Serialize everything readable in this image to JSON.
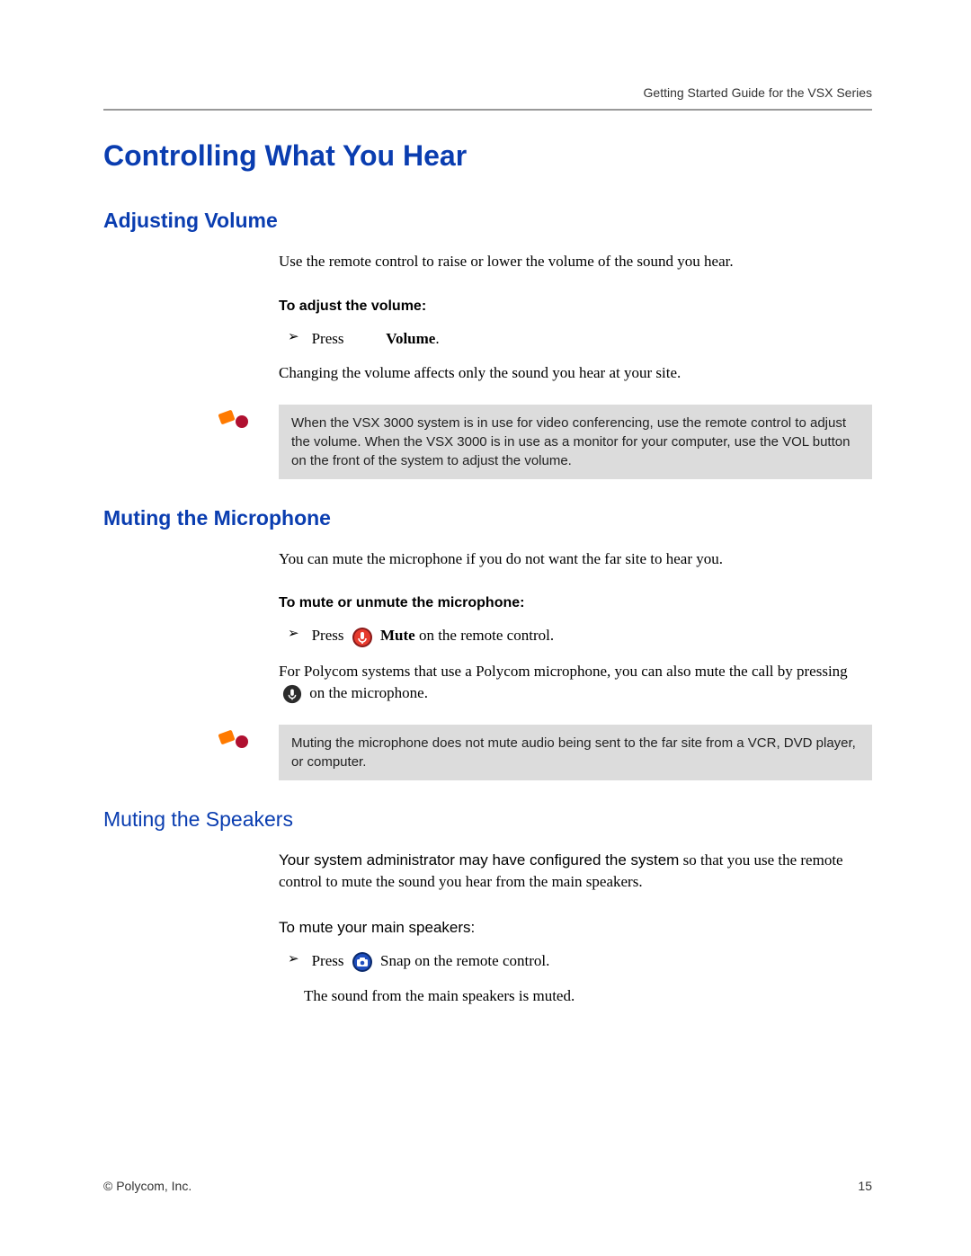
{
  "header": {
    "guide_title": "Getting Started Guide for the VSX Series"
  },
  "h1": "Controlling What You Hear",
  "sections": {
    "adjusting_volume": {
      "title": "Adjusting Volume",
      "intro": "Use the remote control to raise or lower the volume of the sound you hear.",
      "subhead": "To adjust the volume:",
      "bullet_press": "Press",
      "bullet_volume": "Volume",
      "bullet_period": ".",
      "after": "Changing the volume affects only the sound you hear at your site.",
      "note": "When the VSX 3000 system is in use for video conferencing, use the remote control to adjust the volume. When the VSX 3000 is in use as a monitor for your computer, use the VOL button on the front of the system to adjust the volume."
    },
    "muting_mic": {
      "title": "Muting the Microphone",
      "intro": "You can mute the microphone if you do not want the far site to hear you.",
      "subhead": "To mute or unmute the microphone:",
      "bullet_press": "Press",
      "bullet_mute": "Mute",
      "bullet_rest": " on the remote control.",
      "para2_a": "For Polycom systems that use a Polycom microphone, you can also mute the call by pressing ",
      "para2_b": " on the microphone.",
      "note": "Muting the microphone does not mute audio being sent to the far site from a VCR, DVD player, or computer."
    },
    "muting_speakers": {
      "title": "Muting the Speakers",
      "intro_a": "Your system administrator may have configured the system",
      "intro_b": " so that you use the remote control to mute the sound you hear from the main speakers.",
      "subhead": "To mute your main speakers:",
      "bullet_press": "Press",
      "bullet_snap": "Snap on the remote control.",
      "result": "The sound from the main speakers is muted."
    }
  },
  "footer": {
    "copyright": "© Polycom, Inc.",
    "page_number": "15"
  }
}
